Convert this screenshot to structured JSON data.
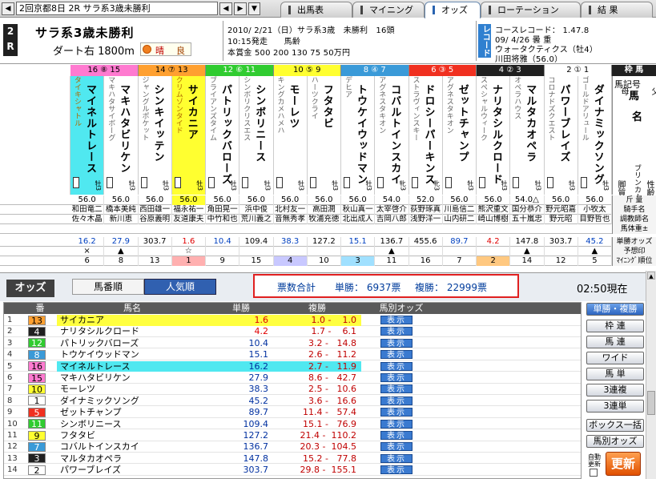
{
  "toolbar": {
    "race_select": "2回京都8日 2R サラ系3歳未勝利",
    "tabs": [
      "出馬表",
      "マイニング",
      "オッズ",
      "ローテーション",
      "結 果"
    ],
    "active_tab": 2
  },
  "race": {
    "no_top": "2",
    "no_bottom": "R",
    "title": "サラ系3歳未勝利",
    "distance": "ダート右 1800m",
    "weather": "晴",
    "going": "良",
    "line1": "2010/ 2/21（日）サラ系3歳　未勝利　16頭",
    "line2": "10:15発走　　馬齢",
    "line3": "本賞金 500 200 130 75 50万円",
    "record_badge": "レコード",
    "record_line1": "コースレコード： 1.47.8",
    "record_line2": "09/ 4/26 曇 重",
    "record_line3": "ウォータクティクス（牡4）",
    "record_line4": "川田将雅（56.0）"
  },
  "grid": {
    "header_waku": "枠 馬",
    "label_kigou": "馬記号",
    "label_haha": "母",
    "label_uma": "馬",
    "label_chichi": "父",
    "label_mei": "名",
    "label_burinkaa": "ブリンカー",
    "label_kyakushitsu": "脚質",
    "label_seirei": "性齢",
    "label_kinryo": "斤 量",
    "label_kishu": "騎手名",
    "label_kyusha": "調教師名",
    "label_bataiju": "馬体重±",
    "label_tansho": "単勝オッズ",
    "label_yoso": "予想印",
    "label_mining": "ﾏｲﾆﾝｸﾞ順位",
    "horses": [
      {
        "num": "16",
        "name": "マイネルトレース",
        "sire": "タイキシャトル",
        "dam": "",
        "sex": "牡3",
        "weight": "56.0",
        "jockey": "和田竜二",
        "trainer": "佐々木晶",
        "odds": "16.2",
        "mark": "×",
        "mining": "6"
      },
      {
        "num": "15",
        "name": "マキハタビリケン",
        "sire": "マキハタサイボーグ",
        "dam": "",
        "sex": "牡3",
        "weight": "56.0",
        "jockey": "橋本美純",
        "trainer": "新川恵",
        "odds": "27.9",
        "mark": "▲",
        "mining": "8"
      },
      {
        "num": "14",
        "name": "シンキイッテン",
        "sire": "ジャングルポケット",
        "dam": "",
        "sex": "牡3",
        "weight": "56.0",
        "jockey": "西田雄一",
        "trainer": "谷原義明",
        "odds": "303.7",
        "mark": "",
        "mining": "13"
      },
      {
        "num": "13",
        "name": "サイカニア",
        "sire": "クリムゾンタイド",
        "dam": "",
        "sex": "牡3",
        "weight": "56.0",
        "jockey": "福永祐一",
        "trainer": "友道康夫",
        "odds": "1.6",
        "mark": "☆",
        "mining": "1"
      },
      {
        "num": "12",
        "name": "パトリックバローズ",
        "sire": "ブライアンズタイム",
        "dam": "",
        "sex": "牡3",
        "weight": "56.0",
        "jockey": "角田晃一",
        "trainer": "中竹和也",
        "odds": "10.4",
        "mark": "",
        "mining": "9"
      },
      {
        "num": "11",
        "name": "シンボリニース",
        "sire": "シンボリクリスエス",
        "dam": "",
        "sex": "牡3",
        "weight": "56.0",
        "jockey": "浜中俊",
        "trainer": "荒川義之",
        "odds": "109.4",
        "mark": "",
        "mining": "15"
      },
      {
        "num": "10",
        "name": "モーレツ",
        "sire": "キングカメハメハ",
        "dam": "",
        "sex": "牡3",
        "weight": "56.0",
        "jockey": "北村友一",
        "trainer": "音無秀孝",
        "odds": "38.3",
        "mark": "",
        "mining": "4"
      },
      {
        "num": "9",
        "name": "フタタビ",
        "sire": "ハーツクライ",
        "dam": "",
        "sex": "牡3",
        "weight": "56.0",
        "jockey": "高田潤",
        "trainer": "牧浦充徳",
        "odds": "127.2",
        "mark": "",
        "mining": "10"
      },
      {
        "num": "8",
        "name": "トウケイウッドマン",
        "sire": "デヒア",
        "dam": "",
        "sex": "牡3",
        "weight": "56.0",
        "jockey": "秋山真一",
        "trainer": "北出成人",
        "odds": "15.1",
        "mark": "",
        "mining": "3"
      },
      {
        "num": "7",
        "name": "コバルトインスカイ",
        "sire": "アグネスタキオン",
        "dam": "",
        "sex": "牝3",
        "weight": "54.0",
        "jockey": "太宰啓介",
        "trainer": "吉岡八郎",
        "odds": "136.7",
        "mark": "▲",
        "mining": "11"
      },
      {
        "num": "6",
        "name": "ドロシーパーキンス",
        "sire": "ストラヴィンスキー",
        "dam": "",
        "sex": "牝3",
        "weight": "52.0",
        "jockey": "荻野琢真",
        "trainer": "浅野洋一",
        "odds": "455.6",
        "mark": "",
        "mining": "16"
      },
      {
        "num": "5",
        "name": "ゼットチャンプ",
        "sire": "アグネスタキオン",
        "dam": "",
        "sex": "牡3",
        "weight": "56.0",
        "jockey": "川島信二",
        "trainer": "山内研二",
        "odds": "89.7",
        "mark": "",
        "mining": "7"
      },
      {
        "num": "4",
        "name": "ナリタシルクロード",
        "sire": "スペシャルウィーク",
        "dam": "",
        "sex": "牡3",
        "weight": "56.0",
        "jockey": "熊沢重文",
        "trainer": "崎山博樹",
        "odds": "4.2",
        "mark": "",
        "mining": "2"
      },
      {
        "num": "3",
        "name": "マルタカオペラ",
        "sire": "オペラハウス",
        "dam": "",
        "sex": "牡3",
        "weight": "54.0△",
        "jockey": "国分恭介",
        "trainer": "五十嵐忠",
        "odds": "147.8",
        "mark": "▲",
        "mining": "14"
      },
      {
        "num": "2",
        "name": "パワーブレイズ",
        "sire": "コロナドズクエスト",
        "dam": "",
        "sex": "牡3",
        "weight": "56.0",
        "jockey": "野元昭嘉",
        "trainer": "野元昭",
        "odds": "303.7",
        "mark": "",
        "mining": "12"
      },
      {
        "num": "1",
        "name": "ダイナミックソング",
        "sire": "ゴールドアリュール",
        "dam": "",
        "sex": "牡3",
        "weight": "56.0",
        "jockey": "小牧太",
        "trainer": "目野哲也",
        "odds": "45.2",
        "mark": "▲",
        "mining": "5"
      }
    ],
    "waku": [
      {
        "label": "16 ⑧ 15",
        "color": "#ff7ad0"
      },
      {
        "label": "14 ⑦ 13",
        "color": "#ffa030"
      },
      {
        "label": "12 ⑥ 11",
        "color": "#30cc30"
      },
      {
        "label": "10 ⑤ 9",
        "color": "#ffff30"
      },
      {
        "label": "8 ④ 7",
        "color": "#3a9ad8"
      },
      {
        "label": "6 ③ 5",
        "color": "#f03020"
      },
      {
        "label": "4 ② 3",
        "color": "#202020"
      },
      {
        "label": "2 ① 1",
        "color": "#ffffff"
      }
    ]
  },
  "odds": {
    "title": "オッズ",
    "sort_by_num": "馬番順",
    "sort_by_pop": "人気順",
    "votes_label": "票数合計",
    "tansho_votes": "単勝： 6937票",
    "fukusho_votes": "複勝： 22999票",
    "now": "02:50現在",
    "headers": [
      "番",
      "馬名",
      "単勝",
      "複勝",
      "馬別オッズ"
    ],
    "show_label": "表示",
    "rows": [
      {
        "rank": "1",
        "num": "13",
        "name": "サイカニア",
        "win": "1.6",
        "place": "1.0 -    1.0",
        "hl": "#ffff40",
        "ncolor": "#ffa030",
        "ntext": "#000"
      },
      {
        "rank": "2",
        "num": "4",
        "name": "ナリタシルクロード",
        "win": "4.2",
        "place": "1.7 -    6.1",
        "hl": "",
        "ncolor": "#202020",
        "ntext": "#fff"
      },
      {
        "rank": "3",
        "num": "12",
        "name": "パトリックバローズ",
        "win": "10.4",
        "place": "3.2 -   14.8",
        "hl": "",
        "ncolor": "#30cc30",
        "ntext": "#fff"
      },
      {
        "rank": "4",
        "num": "8",
        "name": "トウケイウッドマン",
        "win": "15.1",
        "place": "2.6 -   11.2",
        "hl": "",
        "ncolor": "#3a9ad8",
        "ntext": "#fff"
      },
      {
        "rank": "5",
        "num": "16",
        "name": "マイネルトレース",
        "win": "16.2",
        "place": "2.7 -   11.9",
        "hl": "#50e8f0",
        "ncolor": "#ff7ad0",
        "ntext": "#000"
      },
      {
        "rank": "6",
        "num": "15",
        "name": "マキハタビリケン",
        "win": "27.9",
        "place": "8.6 -   42.7",
        "hl": "",
        "ncolor": "#ff7ad0",
        "ntext": "#000"
      },
      {
        "rank": "7",
        "num": "10",
        "name": "モーレツ",
        "win": "38.3",
        "place": "2.5 -   10.6",
        "hl": "",
        "ncolor": "#ffff30",
        "ntext": "#000"
      },
      {
        "rank": "8",
        "num": "1",
        "name": "ダイナミックソング",
        "win": "45.2",
        "place": "3.6 -   16.6",
        "hl": "",
        "ncolor": "#ffffff",
        "ntext": "#000"
      },
      {
        "rank": "9",
        "num": "5",
        "name": "ゼットチャンプ",
        "win": "89.7",
        "place": "11.4 -   57.4",
        "hl": "",
        "ncolor": "#f03020",
        "ntext": "#fff"
      },
      {
        "rank": "10",
        "num": "11",
        "name": "シンボリニース",
        "win": "109.4",
        "place": "15.1 -   76.9",
        "hl": "",
        "ncolor": "#30cc30",
        "ntext": "#fff"
      },
      {
        "rank": "11",
        "num": "9",
        "name": "フタタビ",
        "win": "127.2",
        "place": "21.4 -  110.2",
        "hl": "",
        "ncolor": "#ffff30",
        "ntext": "#000"
      },
      {
        "rank": "12",
        "num": "7",
        "name": "コバルトインスカイ",
        "win": "136.7",
        "place": "20.3 -  104.5",
        "hl": "",
        "ncolor": "#3a9ad8",
        "ntext": "#fff"
      },
      {
        "rank": "13",
        "num": "3",
        "name": "マルタカオペラ",
        "win": "147.8",
        "place": "15.2 -   77.8",
        "hl": "",
        "ncolor": "#202020",
        "ntext": "#fff"
      },
      {
        "rank": "14",
        "num": "2",
        "name": "パワーブレイズ",
        "win": "303.7",
        "place": "29.8 -  155.1",
        "hl": "",
        "ncolor": "#ffffff",
        "ntext": "#000"
      }
    ],
    "side_buttons": [
      "単勝・複勝",
      "枠 連",
      "馬 連",
      "ワイド",
      "馬 単",
      "3連複",
      "3連単",
      "ボックス一括",
      "馬別オッズ"
    ],
    "auto_label": "自動更新",
    "refresh_label": "更新"
  }
}
